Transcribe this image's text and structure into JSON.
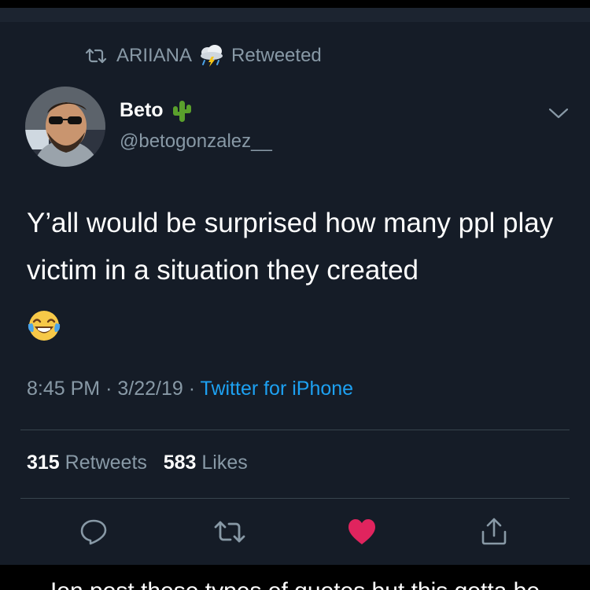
{
  "retweet": {
    "user": "ARIIANA",
    "label": "Retweeted",
    "icon": "retweet-icon",
    "emoji_icon": "cloud-with-lightning-and-rain-icon"
  },
  "author": {
    "name": "Beto",
    "handle": "@betogonzalez__",
    "emoji_icon": "cactus-icon"
  },
  "tweet": {
    "text": "Y’all would be surprised how many ppl play victim in a situation they created",
    "emoji_icon": "face-with-tears-of-joy-icon",
    "time": "8:45 PM",
    "date": "3/22/19",
    "separator": "·",
    "source": "Twitter for iPhone"
  },
  "stats": {
    "retweets_count": "315",
    "retweets_label": "Retweets",
    "likes_count": "583",
    "likes_label": "Likes"
  },
  "actions": {
    "reply_icon": "reply-icon",
    "retweet_icon": "retweet-icon",
    "like_icon": "heart-icon",
    "share_icon": "share-icon",
    "liked": true
  },
  "caption": {
    "text": "Ion post these types of quotes but this gotta be"
  },
  "colors": {
    "background": "#151c27",
    "text_primary": "#ffffff",
    "text_secondary": "#8899a6",
    "link": "#1da1f2",
    "like": "#e0245e"
  }
}
